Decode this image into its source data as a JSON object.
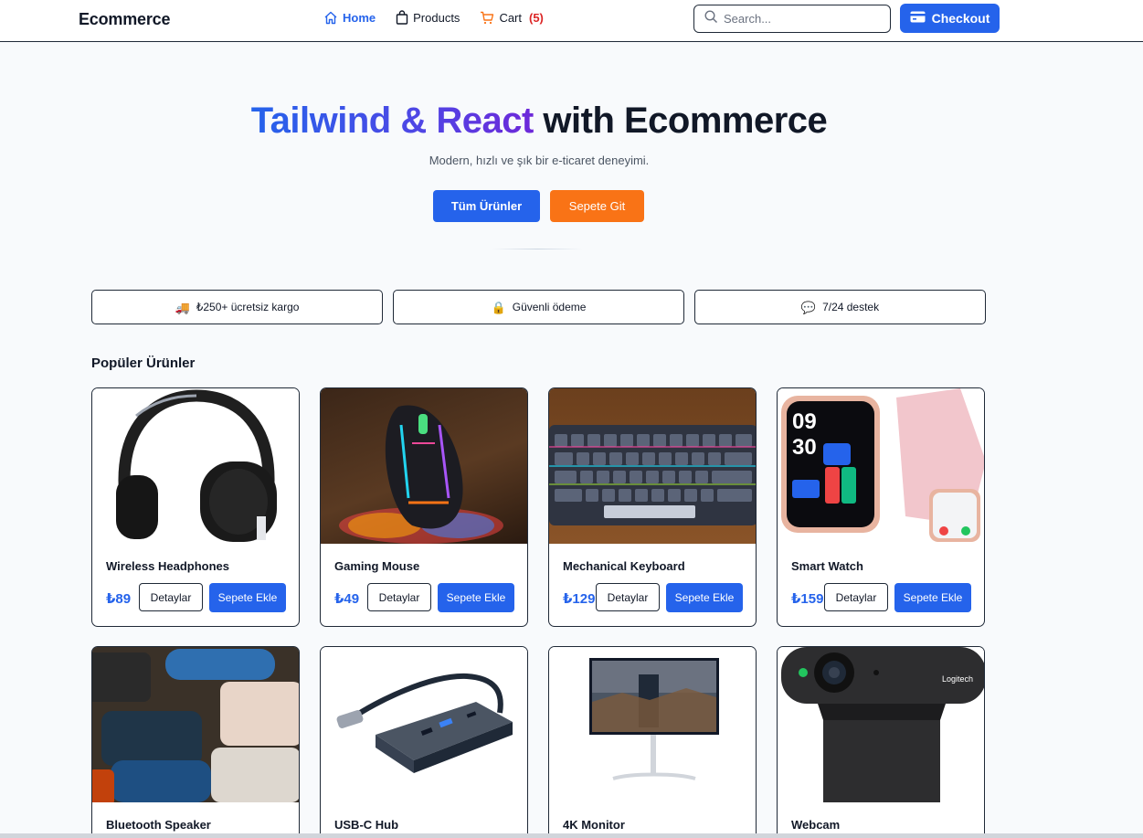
{
  "nav": {
    "brand": "Ecommerce",
    "home": "Home",
    "products": "Products",
    "cart": "Cart",
    "cart_count": "(5)",
    "search_placeholder": "Search...",
    "checkout": "Checkout"
  },
  "hero": {
    "title_highlight": "Tailwind & React",
    "title_rest": " with Ecommerce",
    "subtitle": "Modern, hızlı ve şık bir e-ticaret deneyimi.",
    "primary_button": "Tüm Ürünler",
    "secondary_button": "Sepete Git"
  },
  "features": [
    {
      "icon": "truck-icon",
      "glyph": "🚚",
      "label": "₺250+ ücretsiz kargo"
    },
    {
      "icon": "lock-icon",
      "glyph": "🔒",
      "label": "Güvenli ödeme"
    },
    {
      "icon": "chat-icon",
      "glyph": "💬",
      "label": "7/24 destek"
    }
  ],
  "products_section": {
    "title": "Popüler Ürünler",
    "details_label": "Detaylar",
    "add_label": "Sepete Ekle",
    "items": [
      {
        "name": "Wireless Headphones",
        "price": "₺89"
      },
      {
        "name": "Gaming Mouse",
        "price": "₺49"
      },
      {
        "name": "Mechanical Keyboard",
        "price": "₺129"
      },
      {
        "name": "Smart Watch",
        "price": "₺159"
      },
      {
        "name": "Bluetooth Speaker"
      },
      {
        "name": "USB-C Hub"
      },
      {
        "name": "4K Monitor"
      },
      {
        "name": "Webcam"
      }
    ]
  },
  "colors": {
    "accent": "#2563eb",
    "orange": "#f97316",
    "cart_count": "#dc2626"
  }
}
